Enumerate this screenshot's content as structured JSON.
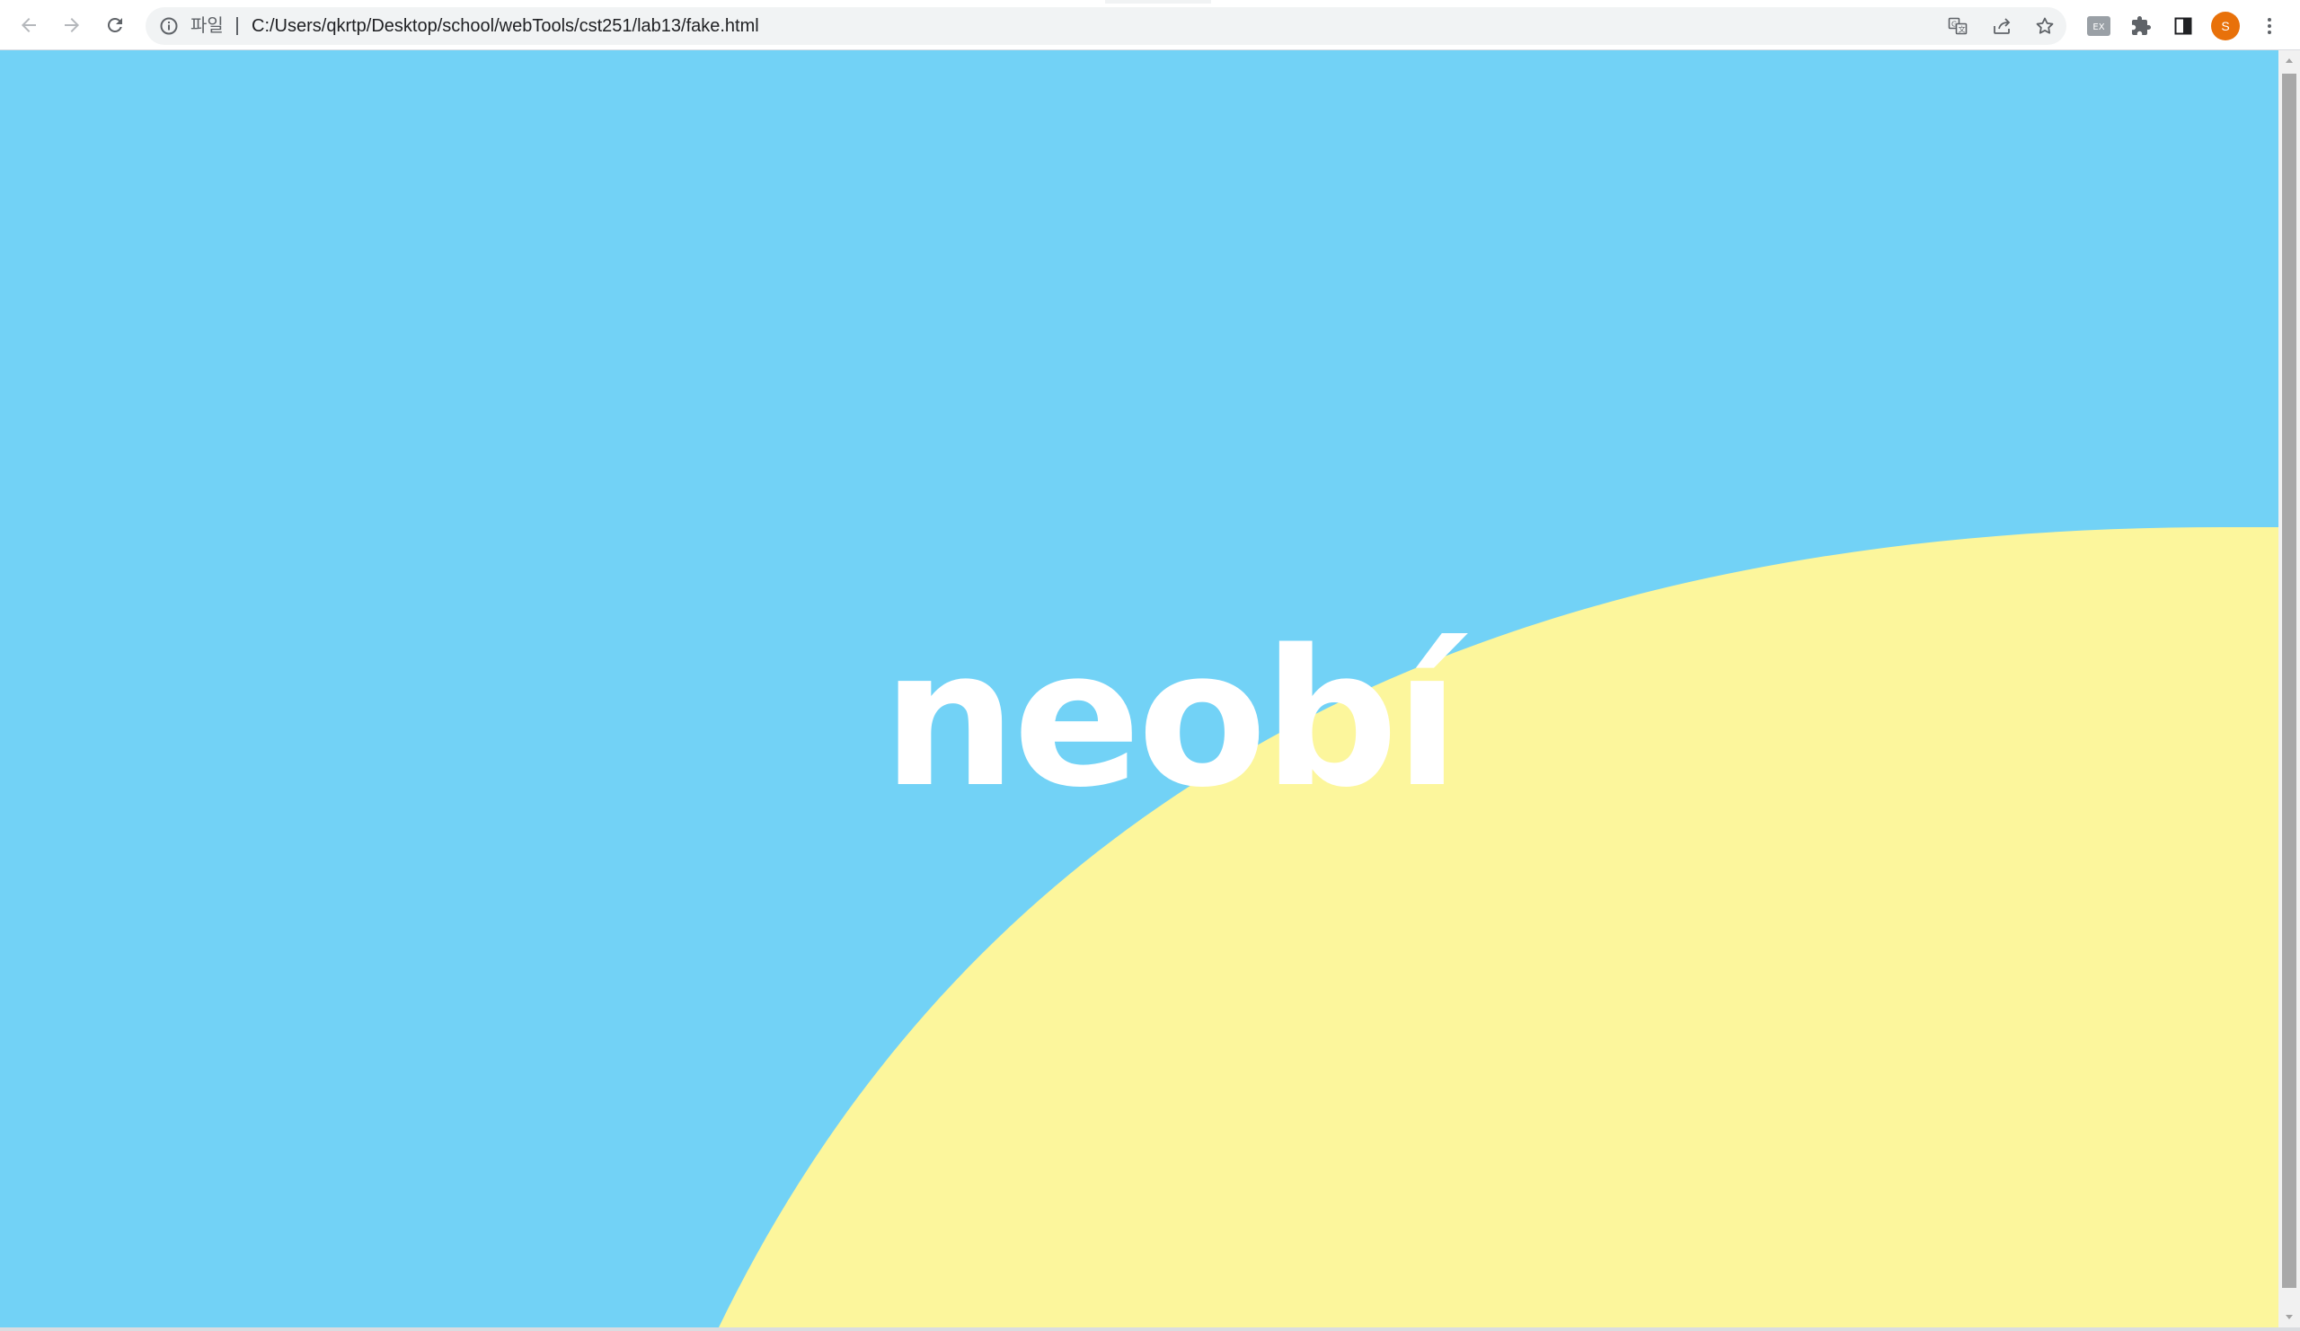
{
  "browser": {
    "back_label": "Back",
    "forward_label": "Forward",
    "reload_label": "Reload",
    "omnibox": {
      "scheme_label": "파일",
      "url": "C:/Users/qkrtp/Desktop/school/webTools/cst251/lab13/fake.html"
    },
    "avatar_initial": "S",
    "extension_badge": "EX"
  },
  "page": {
    "logo_text": "neobí",
    "colors": {
      "sky": "#72d2f6",
      "sun": "#fcf69c",
      "logo": "#ffffff"
    }
  }
}
